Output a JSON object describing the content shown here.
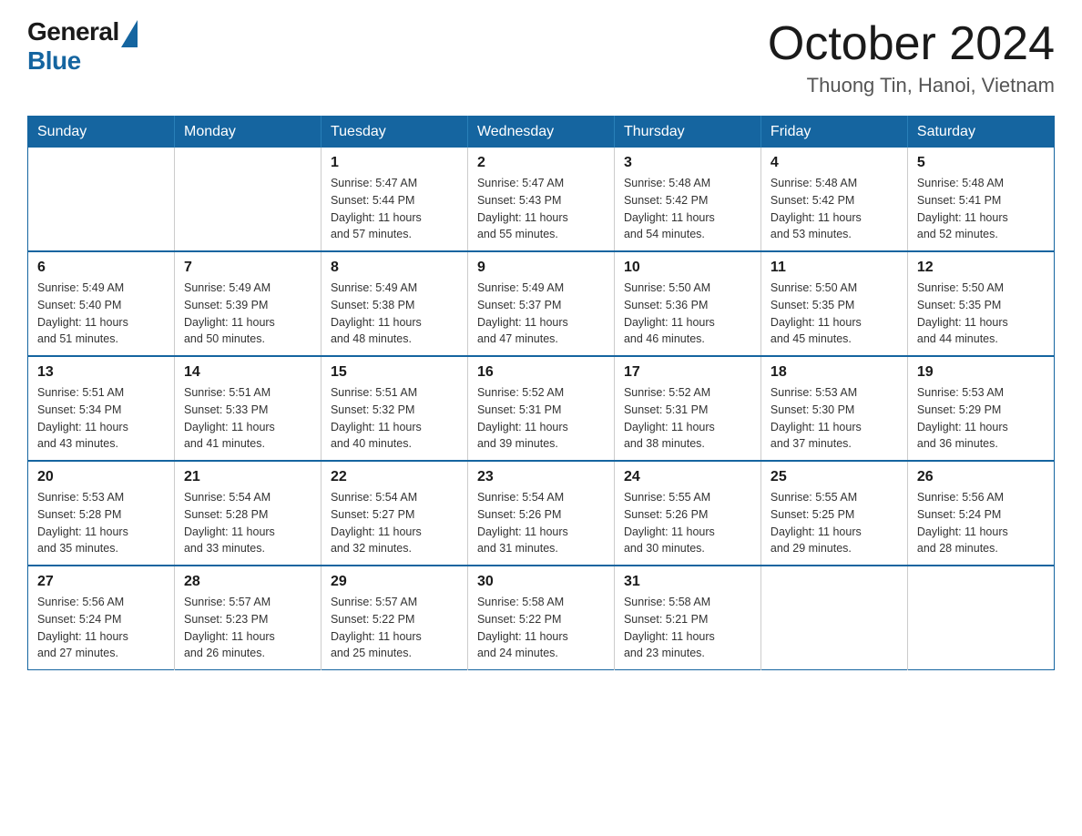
{
  "header": {
    "logo": {
      "general": "General",
      "blue": "Blue"
    },
    "title": "October 2024",
    "location": "Thuong Tin, Hanoi, Vietnam"
  },
  "calendar": {
    "days_of_week": [
      "Sunday",
      "Monday",
      "Tuesday",
      "Wednesday",
      "Thursday",
      "Friday",
      "Saturday"
    ],
    "weeks": [
      [
        {
          "day": "",
          "info": ""
        },
        {
          "day": "",
          "info": ""
        },
        {
          "day": "1",
          "info": "Sunrise: 5:47 AM\nSunset: 5:44 PM\nDaylight: 11 hours\nand 57 minutes."
        },
        {
          "day": "2",
          "info": "Sunrise: 5:47 AM\nSunset: 5:43 PM\nDaylight: 11 hours\nand 55 minutes."
        },
        {
          "day": "3",
          "info": "Sunrise: 5:48 AM\nSunset: 5:42 PM\nDaylight: 11 hours\nand 54 minutes."
        },
        {
          "day": "4",
          "info": "Sunrise: 5:48 AM\nSunset: 5:42 PM\nDaylight: 11 hours\nand 53 minutes."
        },
        {
          "day": "5",
          "info": "Sunrise: 5:48 AM\nSunset: 5:41 PM\nDaylight: 11 hours\nand 52 minutes."
        }
      ],
      [
        {
          "day": "6",
          "info": "Sunrise: 5:49 AM\nSunset: 5:40 PM\nDaylight: 11 hours\nand 51 minutes."
        },
        {
          "day": "7",
          "info": "Sunrise: 5:49 AM\nSunset: 5:39 PM\nDaylight: 11 hours\nand 50 minutes."
        },
        {
          "day": "8",
          "info": "Sunrise: 5:49 AM\nSunset: 5:38 PM\nDaylight: 11 hours\nand 48 minutes."
        },
        {
          "day": "9",
          "info": "Sunrise: 5:49 AM\nSunset: 5:37 PM\nDaylight: 11 hours\nand 47 minutes."
        },
        {
          "day": "10",
          "info": "Sunrise: 5:50 AM\nSunset: 5:36 PM\nDaylight: 11 hours\nand 46 minutes."
        },
        {
          "day": "11",
          "info": "Sunrise: 5:50 AM\nSunset: 5:35 PM\nDaylight: 11 hours\nand 45 minutes."
        },
        {
          "day": "12",
          "info": "Sunrise: 5:50 AM\nSunset: 5:35 PM\nDaylight: 11 hours\nand 44 minutes."
        }
      ],
      [
        {
          "day": "13",
          "info": "Sunrise: 5:51 AM\nSunset: 5:34 PM\nDaylight: 11 hours\nand 43 minutes."
        },
        {
          "day": "14",
          "info": "Sunrise: 5:51 AM\nSunset: 5:33 PM\nDaylight: 11 hours\nand 41 minutes."
        },
        {
          "day": "15",
          "info": "Sunrise: 5:51 AM\nSunset: 5:32 PM\nDaylight: 11 hours\nand 40 minutes."
        },
        {
          "day": "16",
          "info": "Sunrise: 5:52 AM\nSunset: 5:31 PM\nDaylight: 11 hours\nand 39 minutes."
        },
        {
          "day": "17",
          "info": "Sunrise: 5:52 AM\nSunset: 5:31 PM\nDaylight: 11 hours\nand 38 minutes."
        },
        {
          "day": "18",
          "info": "Sunrise: 5:53 AM\nSunset: 5:30 PM\nDaylight: 11 hours\nand 37 minutes."
        },
        {
          "day": "19",
          "info": "Sunrise: 5:53 AM\nSunset: 5:29 PM\nDaylight: 11 hours\nand 36 minutes."
        }
      ],
      [
        {
          "day": "20",
          "info": "Sunrise: 5:53 AM\nSunset: 5:28 PM\nDaylight: 11 hours\nand 35 minutes."
        },
        {
          "day": "21",
          "info": "Sunrise: 5:54 AM\nSunset: 5:28 PM\nDaylight: 11 hours\nand 33 minutes."
        },
        {
          "day": "22",
          "info": "Sunrise: 5:54 AM\nSunset: 5:27 PM\nDaylight: 11 hours\nand 32 minutes."
        },
        {
          "day": "23",
          "info": "Sunrise: 5:54 AM\nSunset: 5:26 PM\nDaylight: 11 hours\nand 31 minutes."
        },
        {
          "day": "24",
          "info": "Sunrise: 5:55 AM\nSunset: 5:26 PM\nDaylight: 11 hours\nand 30 minutes."
        },
        {
          "day": "25",
          "info": "Sunrise: 5:55 AM\nSunset: 5:25 PM\nDaylight: 11 hours\nand 29 minutes."
        },
        {
          "day": "26",
          "info": "Sunrise: 5:56 AM\nSunset: 5:24 PM\nDaylight: 11 hours\nand 28 minutes."
        }
      ],
      [
        {
          "day": "27",
          "info": "Sunrise: 5:56 AM\nSunset: 5:24 PM\nDaylight: 11 hours\nand 27 minutes."
        },
        {
          "day": "28",
          "info": "Sunrise: 5:57 AM\nSunset: 5:23 PM\nDaylight: 11 hours\nand 26 minutes."
        },
        {
          "day": "29",
          "info": "Sunrise: 5:57 AM\nSunset: 5:22 PM\nDaylight: 11 hours\nand 25 minutes."
        },
        {
          "day": "30",
          "info": "Sunrise: 5:58 AM\nSunset: 5:22 PM\nDaylight: 11 hours\nand 24 minutes."
        },
        {
          "day": "31",
          "info": "Sunrise: 5:58 AM\nSunset: 5:21 PM\nDaylight: 11 hours\nand 23 minutes."
        },
        {
          "day": "",
          "info": ""
        },
        {
          "day": "",
          "info": ""
        }
      ]
    ]
  }
}
